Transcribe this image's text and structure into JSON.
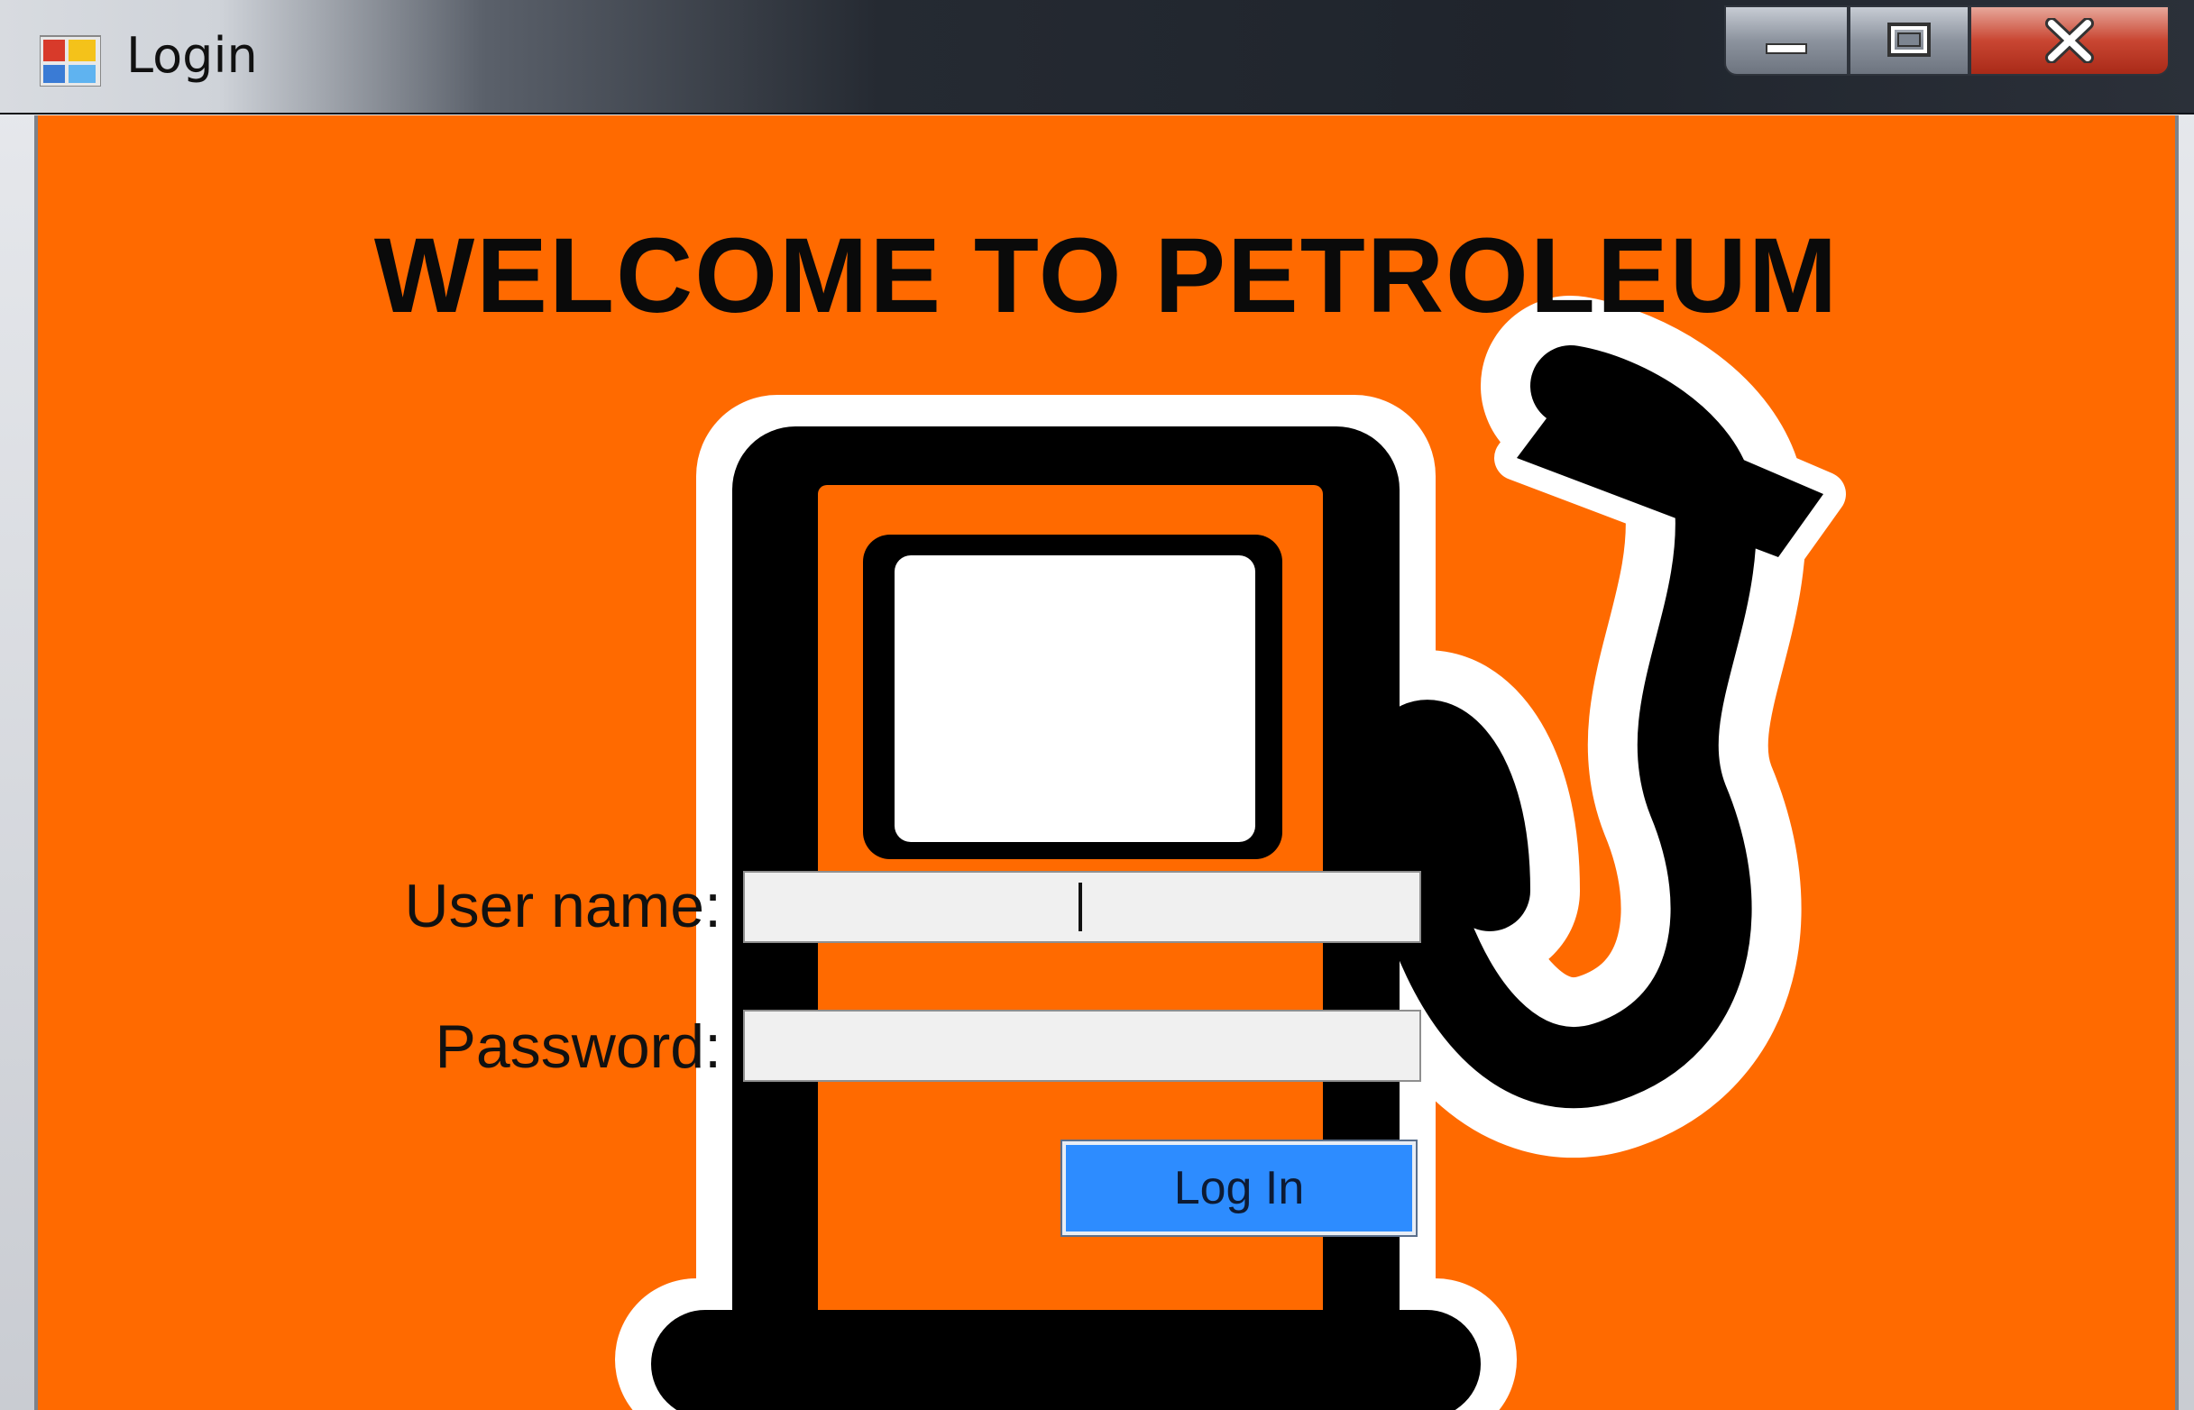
{
  "window": {
    "title": "Login",
    "icon": "windows-forms-app-icon",
    "controls": [
      "minimize-icon",
      "maximize-icon",
      "close-icon"
    ]
  },
  "form": {
    "heading": "WELCOME TO PETROLEUM",
    "background_color": "#ff6a00",
    "illustration": "fuel-pump-icon",
    "username_label": "User name:",
    "username_value": "",
    "password_label": "Password:",
    "password_value": "",
    "login_button": "Log In"
  }
}
